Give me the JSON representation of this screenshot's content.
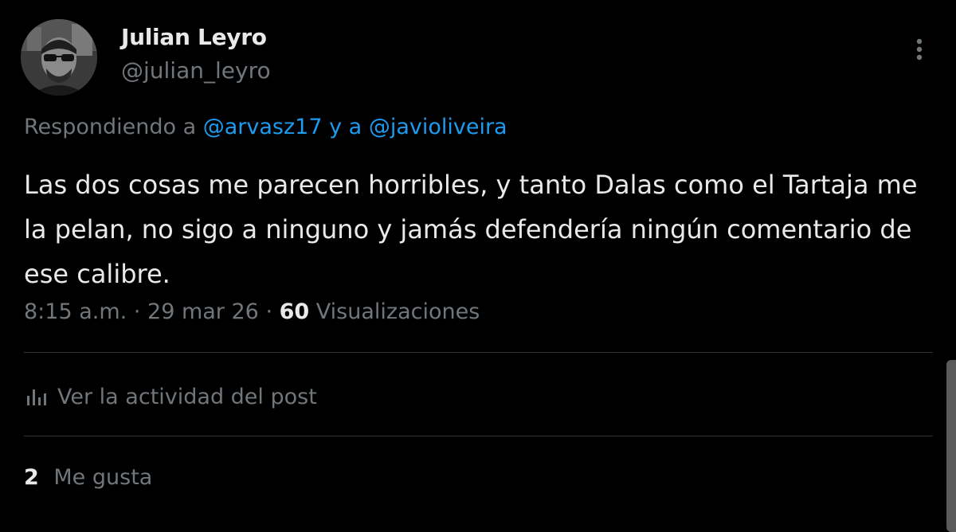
{
  "author": {
    "display_name": "Julian Leyro",
    "handle": "@julian_leyro"
  },
  "reply_context": {
    "prefix": "Respondiendo a",
    "mention_1": "@arvasz17",
    "connector": "y a",
    "mention_2": "@javioliveira"
  },
  "tweet": {
    "text": "Las dos cosas me parecen horribles, y tanto Dalas como el Tartaja me la pelan, no sigo a ninguno y jamás defendería ningún comentario de ese calibre."
  },
  "meta": {
    "time": "8:15 a.m.",
    "separator": "·",
    "date": "29 mar 26",
    "views_count": "60",
    "views_label": "Visualizaciones"
  },
  "activity": {
    "label": "Ver la actividad del post",
    "icon": "analytics-icon"
  },
  "likes": {
    "count": "2",
    "label": "Me gusta"
  },
  "colors": {
    "background": "#000000",
    "primary_text": "#e7e9ea",
    "secondary_text": "#71767b",
    "link": "#1d9bf0",
    "divider": "#2f3336"
  }
}
